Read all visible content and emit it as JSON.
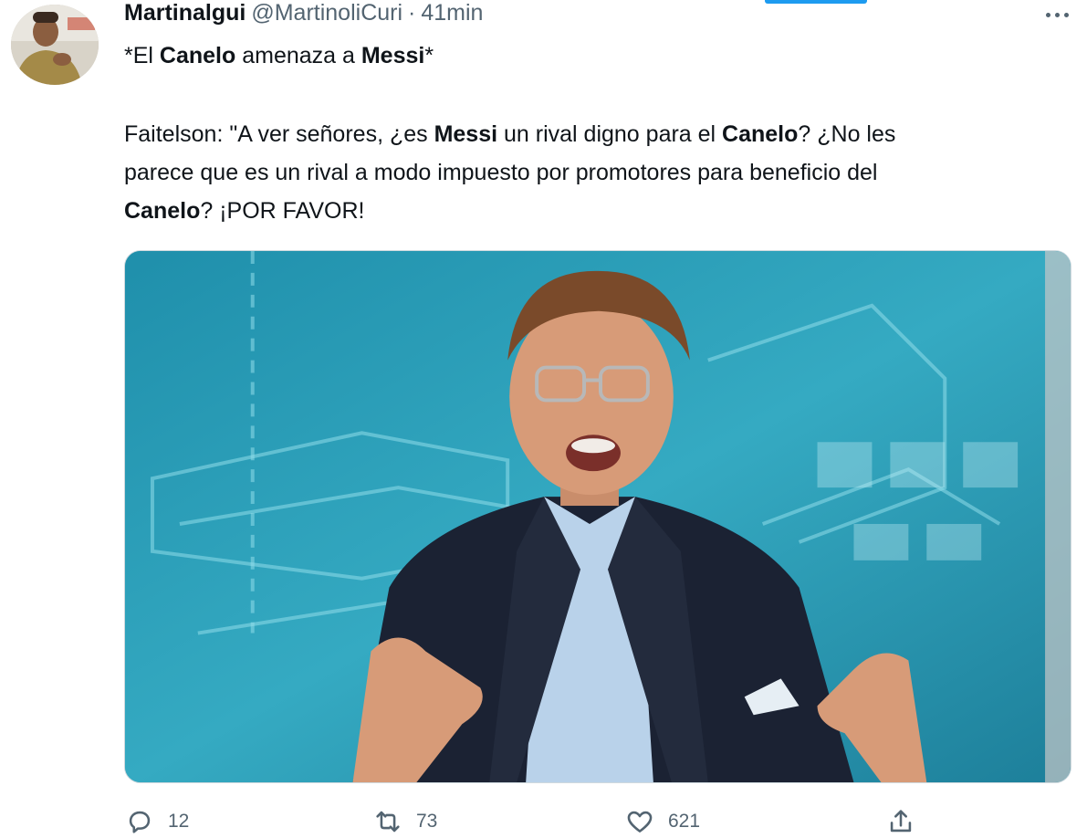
{
  "tweet": {
    "display_name": "Martinalgui",
    "handle": "@MartinoliCuri",
    "separator": "·",
    "time": "41min",
    "headline": {
      "p1": "*El ",
      "b1": "Canelo",
      "p2": " amenaza a ",
      "b2": "Messi",
      "p3": "*"
    },
    "body": {
      "l1_p1": "Faitelson: \"A ver señores, ¿es ",
      "l1_b1": "Messi",
      "l1_p2": " un rival digno para el ",
      "l1_b2": "Canelo",
      "l1_p3": "? ¿No les",
      "l2": "parece que es un rival a modo impuesto por promotores para beneficio del",
      "l3_b1": "Canelo",
      "l3_p1": "? ¡POR FAVOR!"
    },
    "media": {
      "icon": "photo-of-tv-commentator-in-studio"
    },
    "actions": {
      "reply_count": "12",
      "retweet_count": "73",
      "like_count": "621"
    }
  },
  "icons": {
    "reply": "reply-icon",
    "retweet": "retweet-icon",
    "like": "heart-icon",
    "share": "share-icon",
    "more": "more-icon"
  },
  "colors": {
    "accent": "#1d9bf0",
    "text": "#0f1419",
    "secondary": "#536471",
    "studio_teal": "#2a9bb3"
  }
}
